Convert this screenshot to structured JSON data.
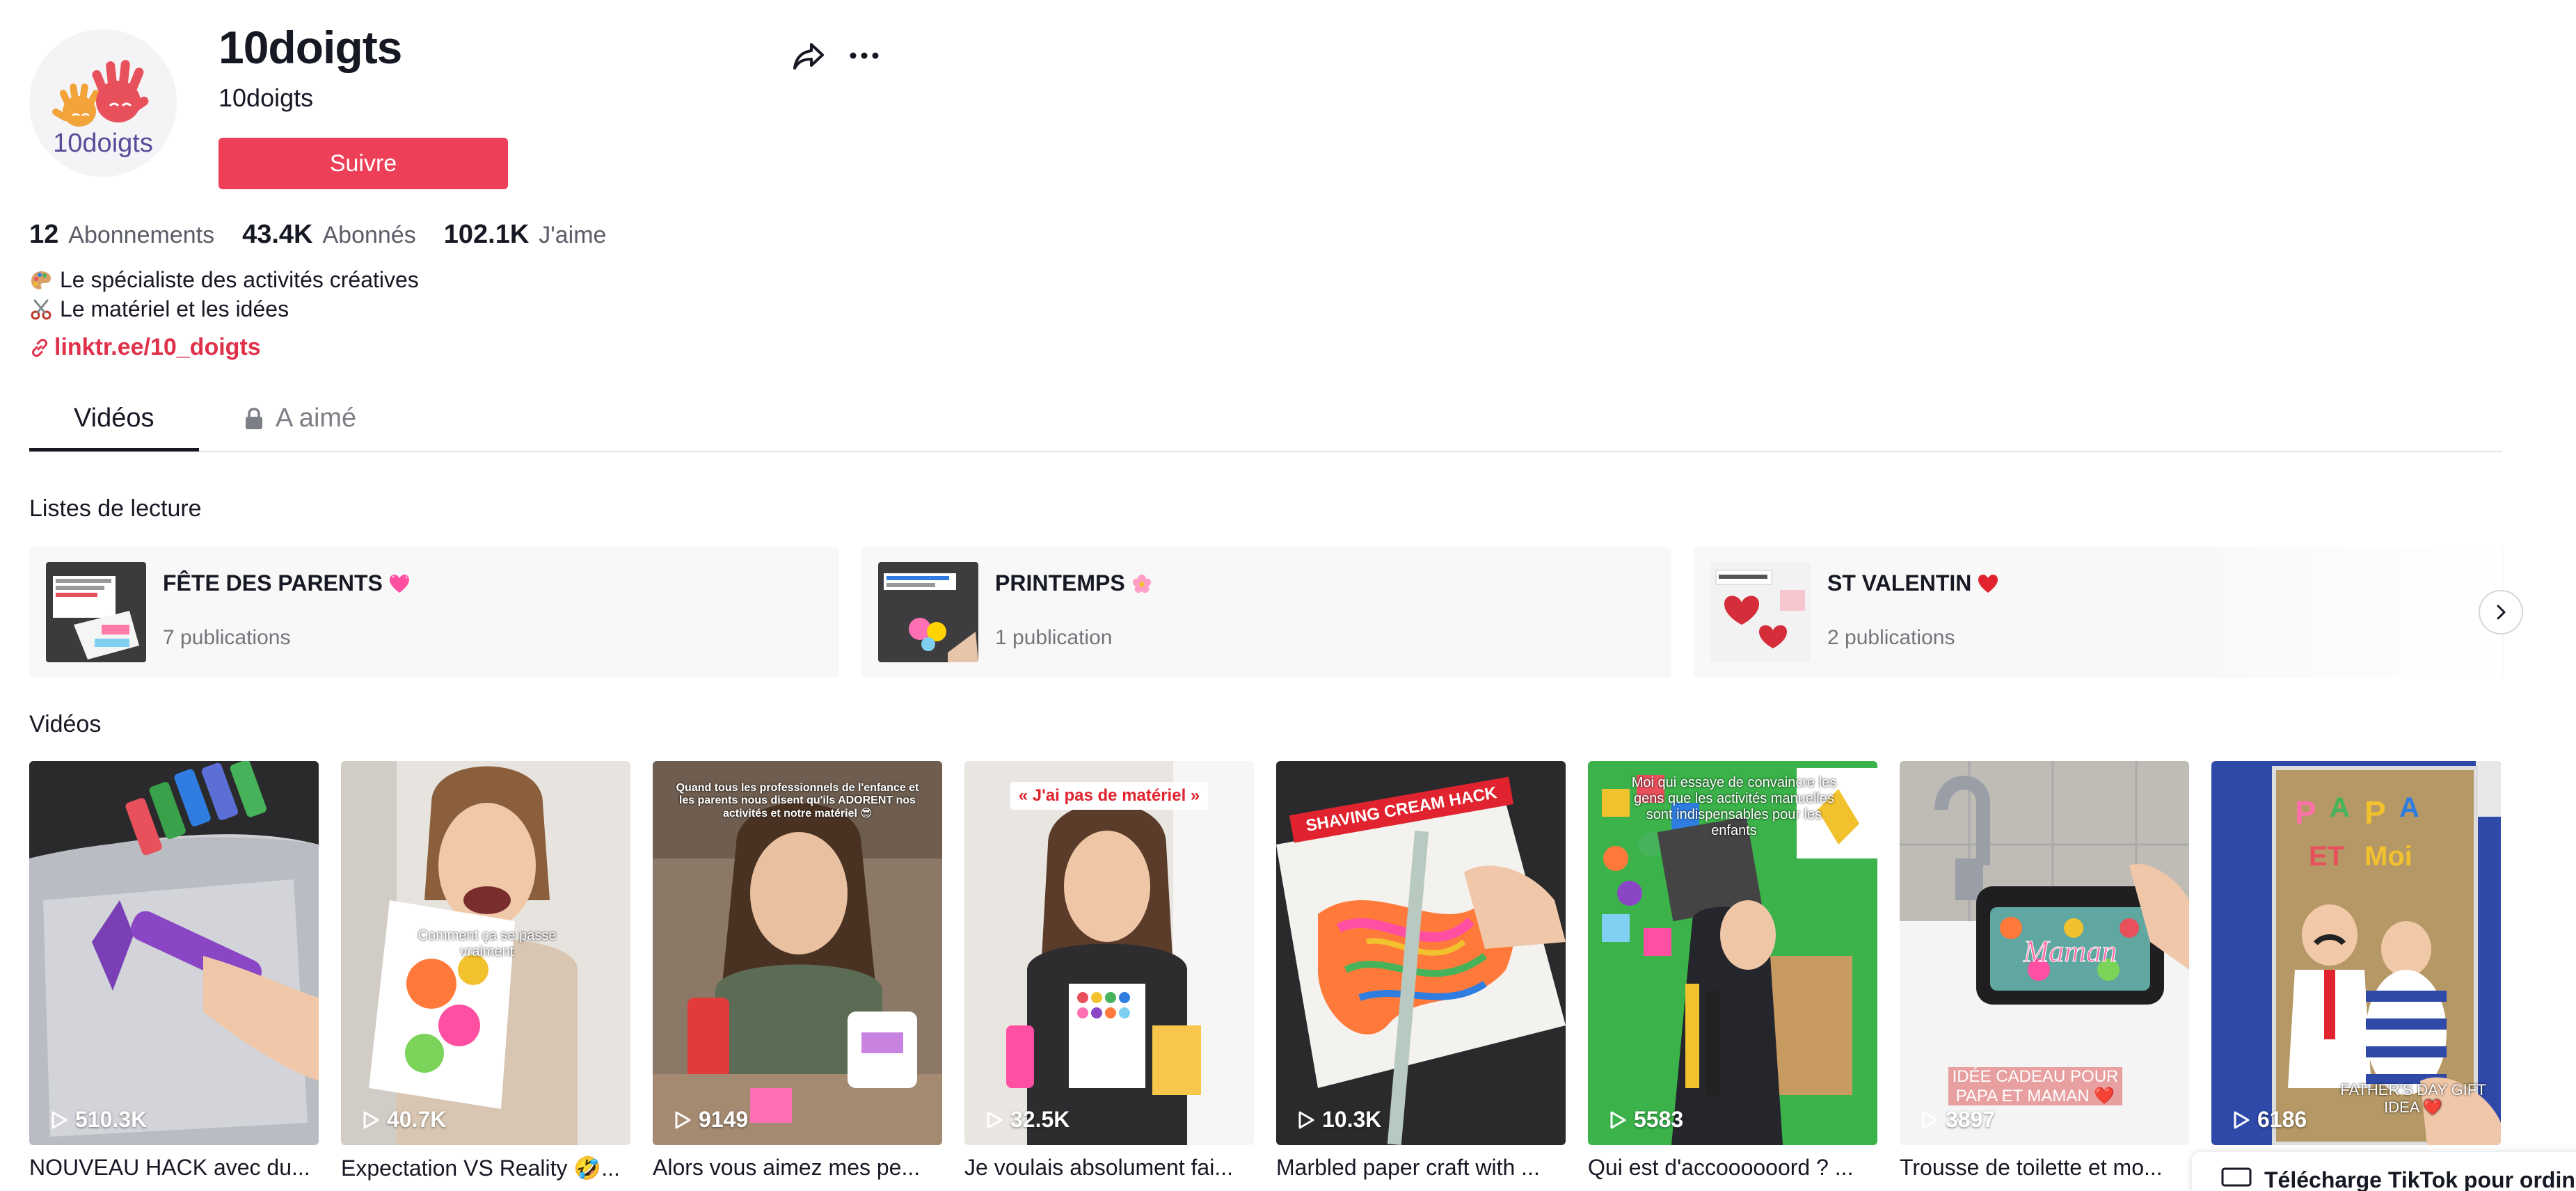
{
  "profile": {
    "title": "10doigts",
    "subtitle": "10doigts",
    "follow_label": "Suivre",
    "logo_text": "10doigts"
  },
  "stats": [
    {
      "value": "12",
      "label": "Abonnements"
    },
    {
      "value": "43.4K",
      "label": "Abonnés"
    },
    {
      "value": "102.1K",
      "label": "J'aime"
    }
  ],
  "bio": {
    "line1": "Le spécialiste des activités créatives",
    "line2": "Le matériel et les idées",
    "link": "linktr.ee/10_doigts"
  },
  "tabs": {
    "videos": "Vidéos",
    "liked": "A aimé"
  },
  "playlists": {
    "title": "Listes de lecture",
    "items": [
      {
        "name": "FÊTE DES PARENTS",
        "count": "7 publications",
        "emoji": "heart-pink"
      },
      {
        "name": "PRINTEMPS",
        "count": "1 publication",
        "emoji": "flower"
      },
      {
        "name": "ST VALENTIN",
        "count": "2 publications",
        "emoji": "heart-red"
      }
    ]
  },
  "videos": {
    "title": "Vidéos",
    "items": [
      {
        "views": "510.3K",
        "title": "NOUVEAU HACK avec du..."
      },
      {
        "views": "40.7K",
        "title": "Expectation VS Reality 🤣...",
        "overlay": "Comment ça se passe vraiment"
      },
      {
        "views": "9149",
        "title": "Alors vous aimez mes pe...",
        "overlay": "Quand tous les professionnels de l'enfance et les parents nous disent qu'ils ADORENT nos activités et notre matériel 😎"
      },
      {
        "views": "32.5K",
        "title": "Je voulais absolument fai...",
        "overlay": "« J'ai pas de matériel »"
      },
      {
        "views": "10.3K",
        "title": "Marbled paper craft with ...",
        "overlay": "SHAVING CREAM HACK"
      },
      {
        "views": "5583",
        "title": "Qui est d'accoooooord ? ...",
        "overlay": "Moi qui essaye de convaincre les gens que les activités manuelles sont indispensables pour les enfants"
      },
      {
        "views": "3897",
        "title": "Trousse de toilette et mo...",
        "overlay": "IDÉE CADEAU POUR PAPA ET MAMAN ❤️"
      },
      {
        "views": "6186",
        "title": "",
        "overlay": "FATHER'S DAY GIFT IDEA ❤️"
      }
    ]
  },
  "download_banner": "Télécharge TikTok pour ordin"
}
